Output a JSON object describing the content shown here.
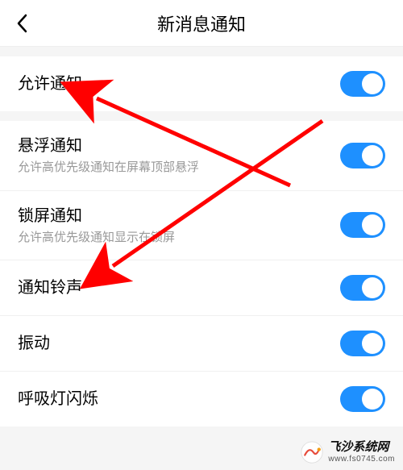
{
  "header": {
    "title": "新消息通知"
  },
  "rows": [
    {
      "label": "允许通知",
      "desc": "",
      "on": true
    },
    {
      "label": "悬浮通知",
      "desc": "允许高优先级通知在屏幕顶部悬浮",
      "on": true
    },
    {
      "label": "锁屏通知",
      "desc": "允许高优先级通知显示在锁屏",
      "on": true
    },
    {
      "label": "通知铃声",
      "desc": "",
      "on": true
    },
    {
      "label": "振动",
      "desc": "",
      "on": true
    },
    {
      "label": "呼吸灯闪烁",
      "desc": "",
      "on": true
    }
  ],
  "watermark": {
    "name": "飞沙系统网",
    "url": "www.fs0745.com"
  },
  "colors": {
    "accent": "#1e90ff",
    "arrow": "#ff0000"
  }
}
